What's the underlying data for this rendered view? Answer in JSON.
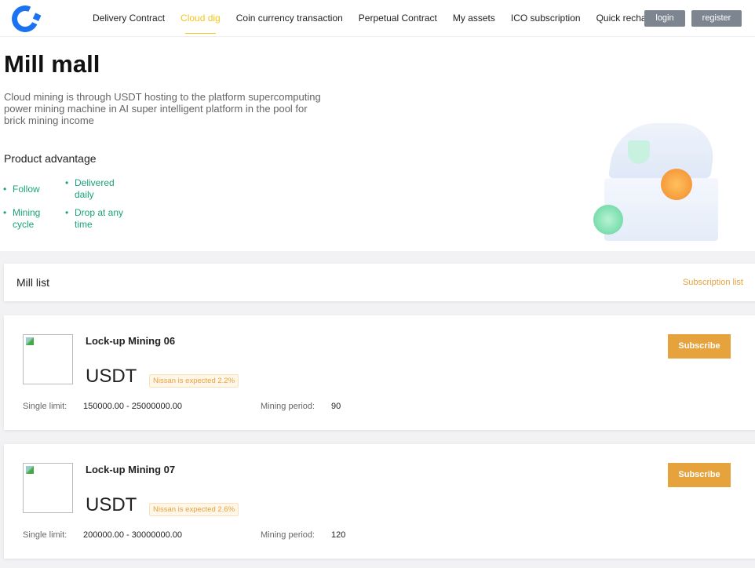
{
  "nav": {
    "items": [
      "Delivery Contract",
      "Cloud dig",
      "Coin currency transaction",
      "Perpetual Contract",
      "My assets",
      "ICO subscription",
      "Quick recharge"
    ],
    "active": 1,
    "login": "login",
    "register": "register"
  },
  "hero": {
    "title": "Mill mall",
    "description": "Cloud mining is through USDT hosting to the platform supercomputing power mining machine in AI super intelligent platform in the pool for brick mining income",
    "advantage_title": "Product advantage",
    "features": [
      "Follow",
      "Delivered daily",
      "Mining cycle",
      "Drop at any time"
    ]
  },
  "list": {
    "title": "Mill list",
    "subscription_link": "Subscription list"
  },
  "products": [
    {
      "name": "Lock-up Mining 06",
      "currency": "USDT",
      "tag": "Nissan is expected 2.2%",
      "limit_label": "Single limit:",
      "limit": "150000.00 - 25000000.00",
      "period_label": "Mining period:",
      "period": "90",
      "button": "Subscribe"
    },
    {
      "name": "Lock-up Mining 07",
      "currency": "USDT",
      "tag": "Nissan is expected 2.6%",
      "limit_label": "Single limit:",
      "limit": "200000.00 - 30000000.00",
      "period_label": "Mining period:",
      "period": "120",
      "button": "Subscribe"
    }
  ],
  "colors": {
    "accent": "#e6a23c",
    "active_nav": "#f5c518",
    "feature": "#1aa37a",
    "logo": "#1a73f0"
  }
}
